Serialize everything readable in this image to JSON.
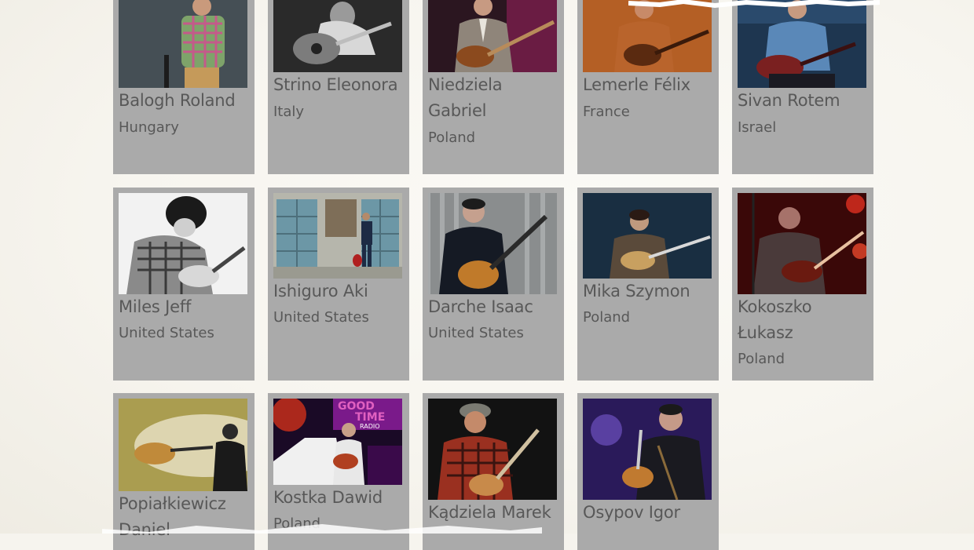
{
  "musicians": [
    {
      "name": "Balogh Roland",
      "country": "Hungary"
    },
    {
      "name": "Strino Eleonora",
      "country": "Italy"
    },
    {
      "name": "Niedziela Gabriel",
      "country": "Poland"
    },
    {
      "name": "Lemerle Félix",
      "country": "France"
    },
    {
      "name": "Sivan Rotem",
      "country": "Israel"
    },
    {
      "name": "Miles Jeff",
      "country": "United States"
    },
    {
      "name": "Ishiguro Aki",
      "country": "United States"
    },
    {
      "name": "Darche Isaac",
      "country": "United States"
    },
    {
      "name": "Mika Szymon",
      "country": "Poland"
    },
    {
      "name": "Kokoszko Łukasz",
      "country": "Poland"
    },
    {
      "name": "Popiałkiewicz Daniel",
      "country": ""
    },
    {
      "name": "Kostka Dawid",
      "country": "Poland"
    },
    {
      "name": "Kądziela Marek",
      "country": ""
    },
    {
      "name": "Osypov Igor",
      "country": ""
    }
  ],
  "colors": {
    "card_background": "#aaaaaa",
    "text": "#585858",
    "page_background": "#f6f4ee"
  },
  "photo_text": {
    "good_time_sign_line1": "GOOD",
    "good_time_sign_line2": "TIME",
    "good_time_sign_line3": "RADIO"
  }
}
